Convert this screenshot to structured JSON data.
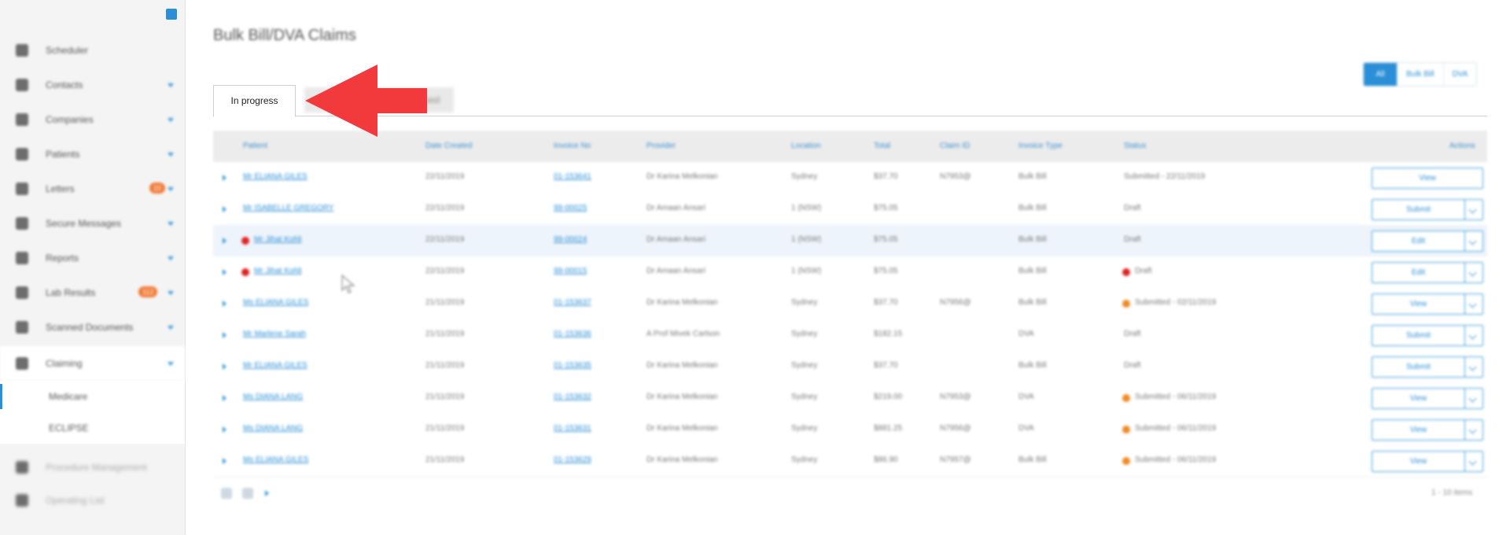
{
  "sidebar": {
    "items": [
      {
        "label": "Scheduler",
        "icon": "calendar-icon",
        "chevron": false
      },
      {
        "label": "Contacts",
        "icon": "contacts-icon",
        "chevron": true
      },
      {
        "label": "Companies",
        "icon": "building-icon",
        "chevron": true
      },
      {
        "label": "Patients",
        "icon": "person-icon",
        "chevron": true
      },
      {
        "label": "Letters",
        "icon": "envelope-icon",
        "chevron": true,
        "badge": "10"
      },
      {
        "label": "Secure Messages",
        "icon": "message-icon",
        "chevron": true
      },
      {
        "label": "Reports",
        "icon": "report-icon",
        "chevron": true
      },
      {
        "label": "Lab Results",
        "icon": "lab-icon",
        "chevron": true,
        "badge": "112"
      },
      {
        "label": "Scanned Documents",
        "icon": "document-icon",
        "chevron": true
      },
      {
        "label": "Claiming",
        "icon": "claiming-icon",
        "chevron": true,
        "active": true
      }
    ],
    "sub_items": [
      {
        "label": "Medicare",
        "active": true
      },
      {
        "label": "ECLIPSE",
        "active": false
      }
    ],
    "lower_items": [
      {
        "label": "Procedure Management",
        "icon": "procedure-icon"
      },
      {
        "label": "Operating List",
        "icon": "list-icon"
      }
    ]
  },
  "page": {
    "title": "Bulk Bill/DVA Claims"
  },
  "filters": {
    "options": [
      "All",
      "Bulk Bill",
      "DVA"
    ],
    "selected": "All"
  },
  "tabs": {
    "in_progress": "In progress",
    "other": "Processed"
  },
  "table": {
    "columns": [
      "Patient",
      "Date Created",
      "Invoice No",
      "Provider",
      "Location",
      "Total",
      "Claim ID",
      "Invoice Type",
      "Status",
      "Actions"
    ],
    "rows": [
      {
        "patient": "Mr ELIANA GILES",
        "date": "22/11/2019",
        "invoice": "01-153641",
        "provider": "Dr Karina Melkonian",
        "location": "Sydney",
        "total": "$37.70",
        "claim_id": "N7953@",
        "type": "Bulk Bill",
        "status": "Submitted - 22/11/2019",
        "status_dot": "",
        "patient_dot": false,
        "action": "View",
        "split": false
      },
      {
        "patient": "Mr ISABELLE GREGORY",
        "date": "22/11/2019",
        "invoice": "99-00025",
        "provider": "Dr Amaan Ansari",
        "location": "1 (NSW)",
        "total": "$75.05",
        "claim_id": "",
        "type": "Bulk Bill",
        "status": "Draft",
        "status_dot": "",
        "patient_dot": false,
        "action": "Submit",
        "split": true
      },
      {
        "patient": "Mr Jihat Kohli",
        "date": "22/11/2019",
        "invoice": "99-00024",
        "provider": "Dr Amaan Ansari",
        "location": "1 (NSW)",
        "total": "$75.05",
        "claim_id": "",
        "type": "Bulk Bill",
        "status": "Draft",
        "status_dot": "",
        "patient_dot": true,
        "action": "Edit",
        "split": true,
        "highlight": true
      },
      {
        "patient": "Mr Jihat Kohli",
        "date": "22/11/2019",
        "invoice": "99-00015",
        "provider": "Dr Amaan Ansari",
        "location": "1 (NSW)",
        "total": "$75.05",
        "claim_id": "",
        "type": "Bulk Bill",
        "status": "Draft",
        "status_dot": "red",
        "patient_dot": true,
        "action": "Edit",
        "split": true
      },
      {
        "patient": "Ms ELIANA GILES",
        "date": "21/11/2019",
        "invoice": "01-153637",
        "provider": "Dr Karina Melkonian",
        "location": "Sydney",
        "total": "$37.70",
        "claim_id": "N7956@",
        "type": "Bulk Bill",
        "status": "Submitted - 02/11/2019",
        "status_dot": "orange",
        "patient_dot": false,
        "action": "View",
        "split": true
      },
      {
        "patient": "Mr Marlene Sarah",
        "date": "21/11/2019",
        "invoice": "01-153636",
        "provider": "A Prof Mivek Carlson",
        "location": "Sydney",
        "total": "$182.15",
        "claim_id": "",
        "type": "DVA",
        "status": "Draft",
        "status_dot": "",
        "patient_dot": false,
        "action": "Submit",
        "split": true
      },
      {
        "patient": "Mr ELIANA GILES",
        "date": "21/11/2019",
        "invoice": "01-153635",
        "provider": "Dr Karina Melkonian",
        "location": "Sydney",
        "total": "$37.70",
        "claim_id": "",
        "type": "Bulk Bill",
        "status": "Draft",
        "status_dot": "",
        "patient_dot": false,
        "action": "Submit",
        "split": true
      },
      {
        "patient": "Ms DIANA LANG",
        "date": "21/11/2019",
        "invoice": "01-153632",
        "provider": "Dr Karina Melkonian",
        "location": "Sydney",
        "total": "$219.00",
        "claim_id": "N7953@",
        "type": "DVA",
        "status": "Submitted - 06/11/2019",
        "status_dot": "orange",
        "patient_dot": false,
        "action": "View",
        "split": true
      },
      {
        "patient": "Ms DIANA LANG",
        "date": "21/11/2019",
        "invoice": "01-153631",
        "provider": "Dr Karina Melkonian",
        "location": "Sydney",
        "total": "$881.25",
        "claim_id": "N7956@",
        "type": "DVA",
        "status": "Submitted - 06/11/2019",
        "status_dot": "orange",
        "patient_dot": false,
        "action": "View",
        "split": true
      },
      {
        "patient": "Ms ELIANA GILES",
        "date": "21/11/2019",
        "invoice": "01-153629",
        "provider": "Dr Karina Melkonian",
        "location": "Sydney",
        "total": "$86.90",
        "claim_id": "N7957@",
        "type": "Bulk Bill",
        "status": "Submitted - 06/11/2019",
        "status_dot": "orange",
        "patient_dot": false,
        "action": "View",
        "split": true
      }
    ]
  },
  "pager": {
    "info": "1 - 10 items"
  },
  "colors": {
    "accent": "#2a8fd6",
    "badge": "#f07b39",
    "arrow": "#f2393c",
    "error_dot": "#e02424",
    "warn_dot": "#f08a24"
  }
}
